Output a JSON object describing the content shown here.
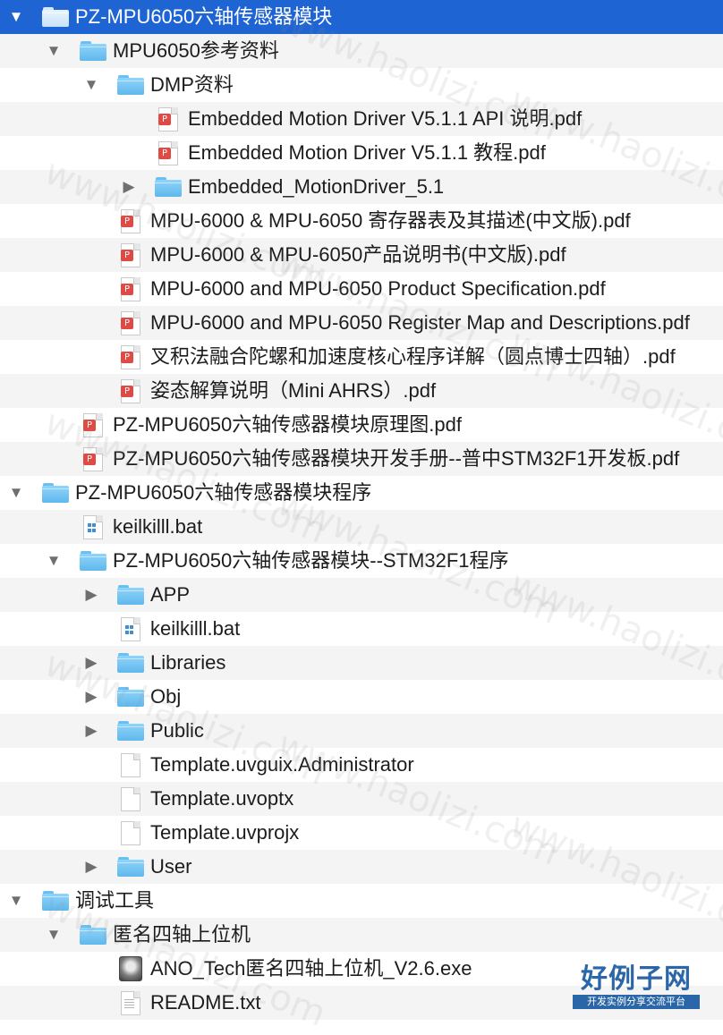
{
  "tree": [
    {
      "depth": 0,
      "expand": "expanded",
      "icon": "folder-icon",
      "label": "PZ-MPU6050六轴传感器模块",
      "selected": true
    },
    {
      "depth": 1,
      "expand": "expanded",
      "icon": "folder-icon",
      "label": "MPU6050参考资料"
    },
    {
      "depth": 2,
      "expand": "expanded",
      "icon": "folder-icon",
      "label": "DMP资料"
    },
    {
      "depth": 3,
      "expand": "none",
      "icon": "pdf-file-icon",
      "label": "Embedded Motion Driver V5.1.1 API 说明.pdf"
    },
    {
      "depth": 3,
      "expand": "none",
      "icon": "pdf-file-icon",
      "label": "Embedded Motion Driver V5.1.1 教程.pdf"
    },
    {
      "depth": 3,
      "expand": "collapsed",
      "icon": "folder-icon",
      "label": "Embedded_MotionDriver_5.1"
    },
    {
      "depth": 2,
      "expand": "none",
      "icon": "pdf-file-icon",
      "label": "MPU-6000 & MPU-6050 寄存器表及其描述(中文版).pdf"
    },
    {
      "depth": 2,
      "expand": "none",
      "icon": "pdf-file-icon",
      "label": "MPU-6000 & MPU-6050产品说明书(中文版).pdf"
    },
    {
      "depth": 2,
      "expand": "none",
      "icon": "pdf-file-icon",
      "label": "MPU-6000 and MPU-6050 Product Specification.pdf"
    },
    {
      "depth": 2,
      "expand": "none",
      "icon": "pdf-file-icon",
      "label": "MPU-6000 and MPU-6050 Register Map and Descriptions.pdf"
    },
    {
      "depth": 2,
      "expand": "none",
      "icon": "pdf-file-icon",
      "label": "叉积法融合陀螺和加速度核心程序详解（圆点博士四轴）.pdf"
    },
    {
      "depth": 2,
      "expand": "none",
      "icon": "pdf-file-icon",
      "label": "姿态解算说明（Mini AHRS）.pdf"
    },
    {
      "depth": 1,
      "expand": "none",
      "icon": "pdf-file-icon",
      "label": "PZ-MPU6050六轴传感器模块原理图.pdf"
    },
    {
      "depth": 1,
      "expand": "none",
      "icon": "pdf-file-icon",
      "label": "PZ-MPU6050六轴传感器模块开发手册--普中STM32F1开发板.pdf"
    },
    {
      "depth": 0,
      "expand": "expanded",
      "icon": "folder-icon",
      "label": "PZ-MPU6050六轴传感器模块程序"
    },
    {
      "depth": 1,
      "expand": "none",
      "icon": "bat-file-icon",
      "label": "keilkilll.bat"
    },
    {
      "depth": 1,
      "expand": "expanded",
      "icon": "folder-icon",
      "label": "PZ-MPU6050六轴传感器模块--STM32F1程序"
    },
    {
      "depth": 2,
      "expand": "collapsed",
      "icon": "folder-icon",
      "label": "APP"
    },
    {
      "depth": 2,
      "expand": "none",
      "icon": "bat-file-icon",
      "label": "keilkilll.bat"
    },
    {
      "depth": 2,
      "expand": "collapsed",
      "icon": "folder-icon",
      "label": "Libraries"
    },
    {
      "depth": 2,
      "expand": "collapsed",
      "icon": "folder-icon",
      "label": "Obj"
    },
    {
      "depth": 2,
      "expand": "collapsed",
      "icon": "folder-icon",
      "label": "Public"
    },
    {
      "depth": 2,
      "expand": "none",
      "icon": "document-icon",
      "label": "Template.uvguix.Administrator"
    },
    {
      "depth": 2,
      "expand": "none",
      "icon": "document-icon",
      "label": "Template.uvoptx"
    },
    {
      "depth": 2,
      "expand": "none",
      "icon": "document-icon",
      "label": "Template.uvprojx"
    },
    {
      "depth": 2,
      "expand": "collapsed",
      "icon": "folder-icon",
      "label": "User"
    },
    {
      "depth": 0,
      "expand": "expanded",
      "icon": "folder-icon",
      "label": "调试工具"
    },
    {
      "depth": 1,
      "expand": "expanded",
      "icon": "folder-icon",
      "label": "匿名四轴上位机"
    },
    {
      "depth": 2,
      "expand": "none",
      "icon": "app-icon",
      "label": "ANO_Tech匿名四轴上位机_V2.6.exe"
    },
    {
      "depth": 2,
      "expand": "none",
      "icon": "text-file-icon",
      "label": "README.txt"
    }
  ],
  "glyphs": {
    "expanded": "▼",
    "collapsed": "▶",
    "pdf": "P"
  },
  "watermark": "www.haolizi.com",
  "logo": {
    "title": "好例子网",
    "subtitle": "开发实例分享交流平台"
  },
  "colors": {
    "selection": "#1e64d2",
    "folder": "#5fb8ec",
    "pdf": "#e04a45",
    "zebra": "#f4f4f5"
  }
}
